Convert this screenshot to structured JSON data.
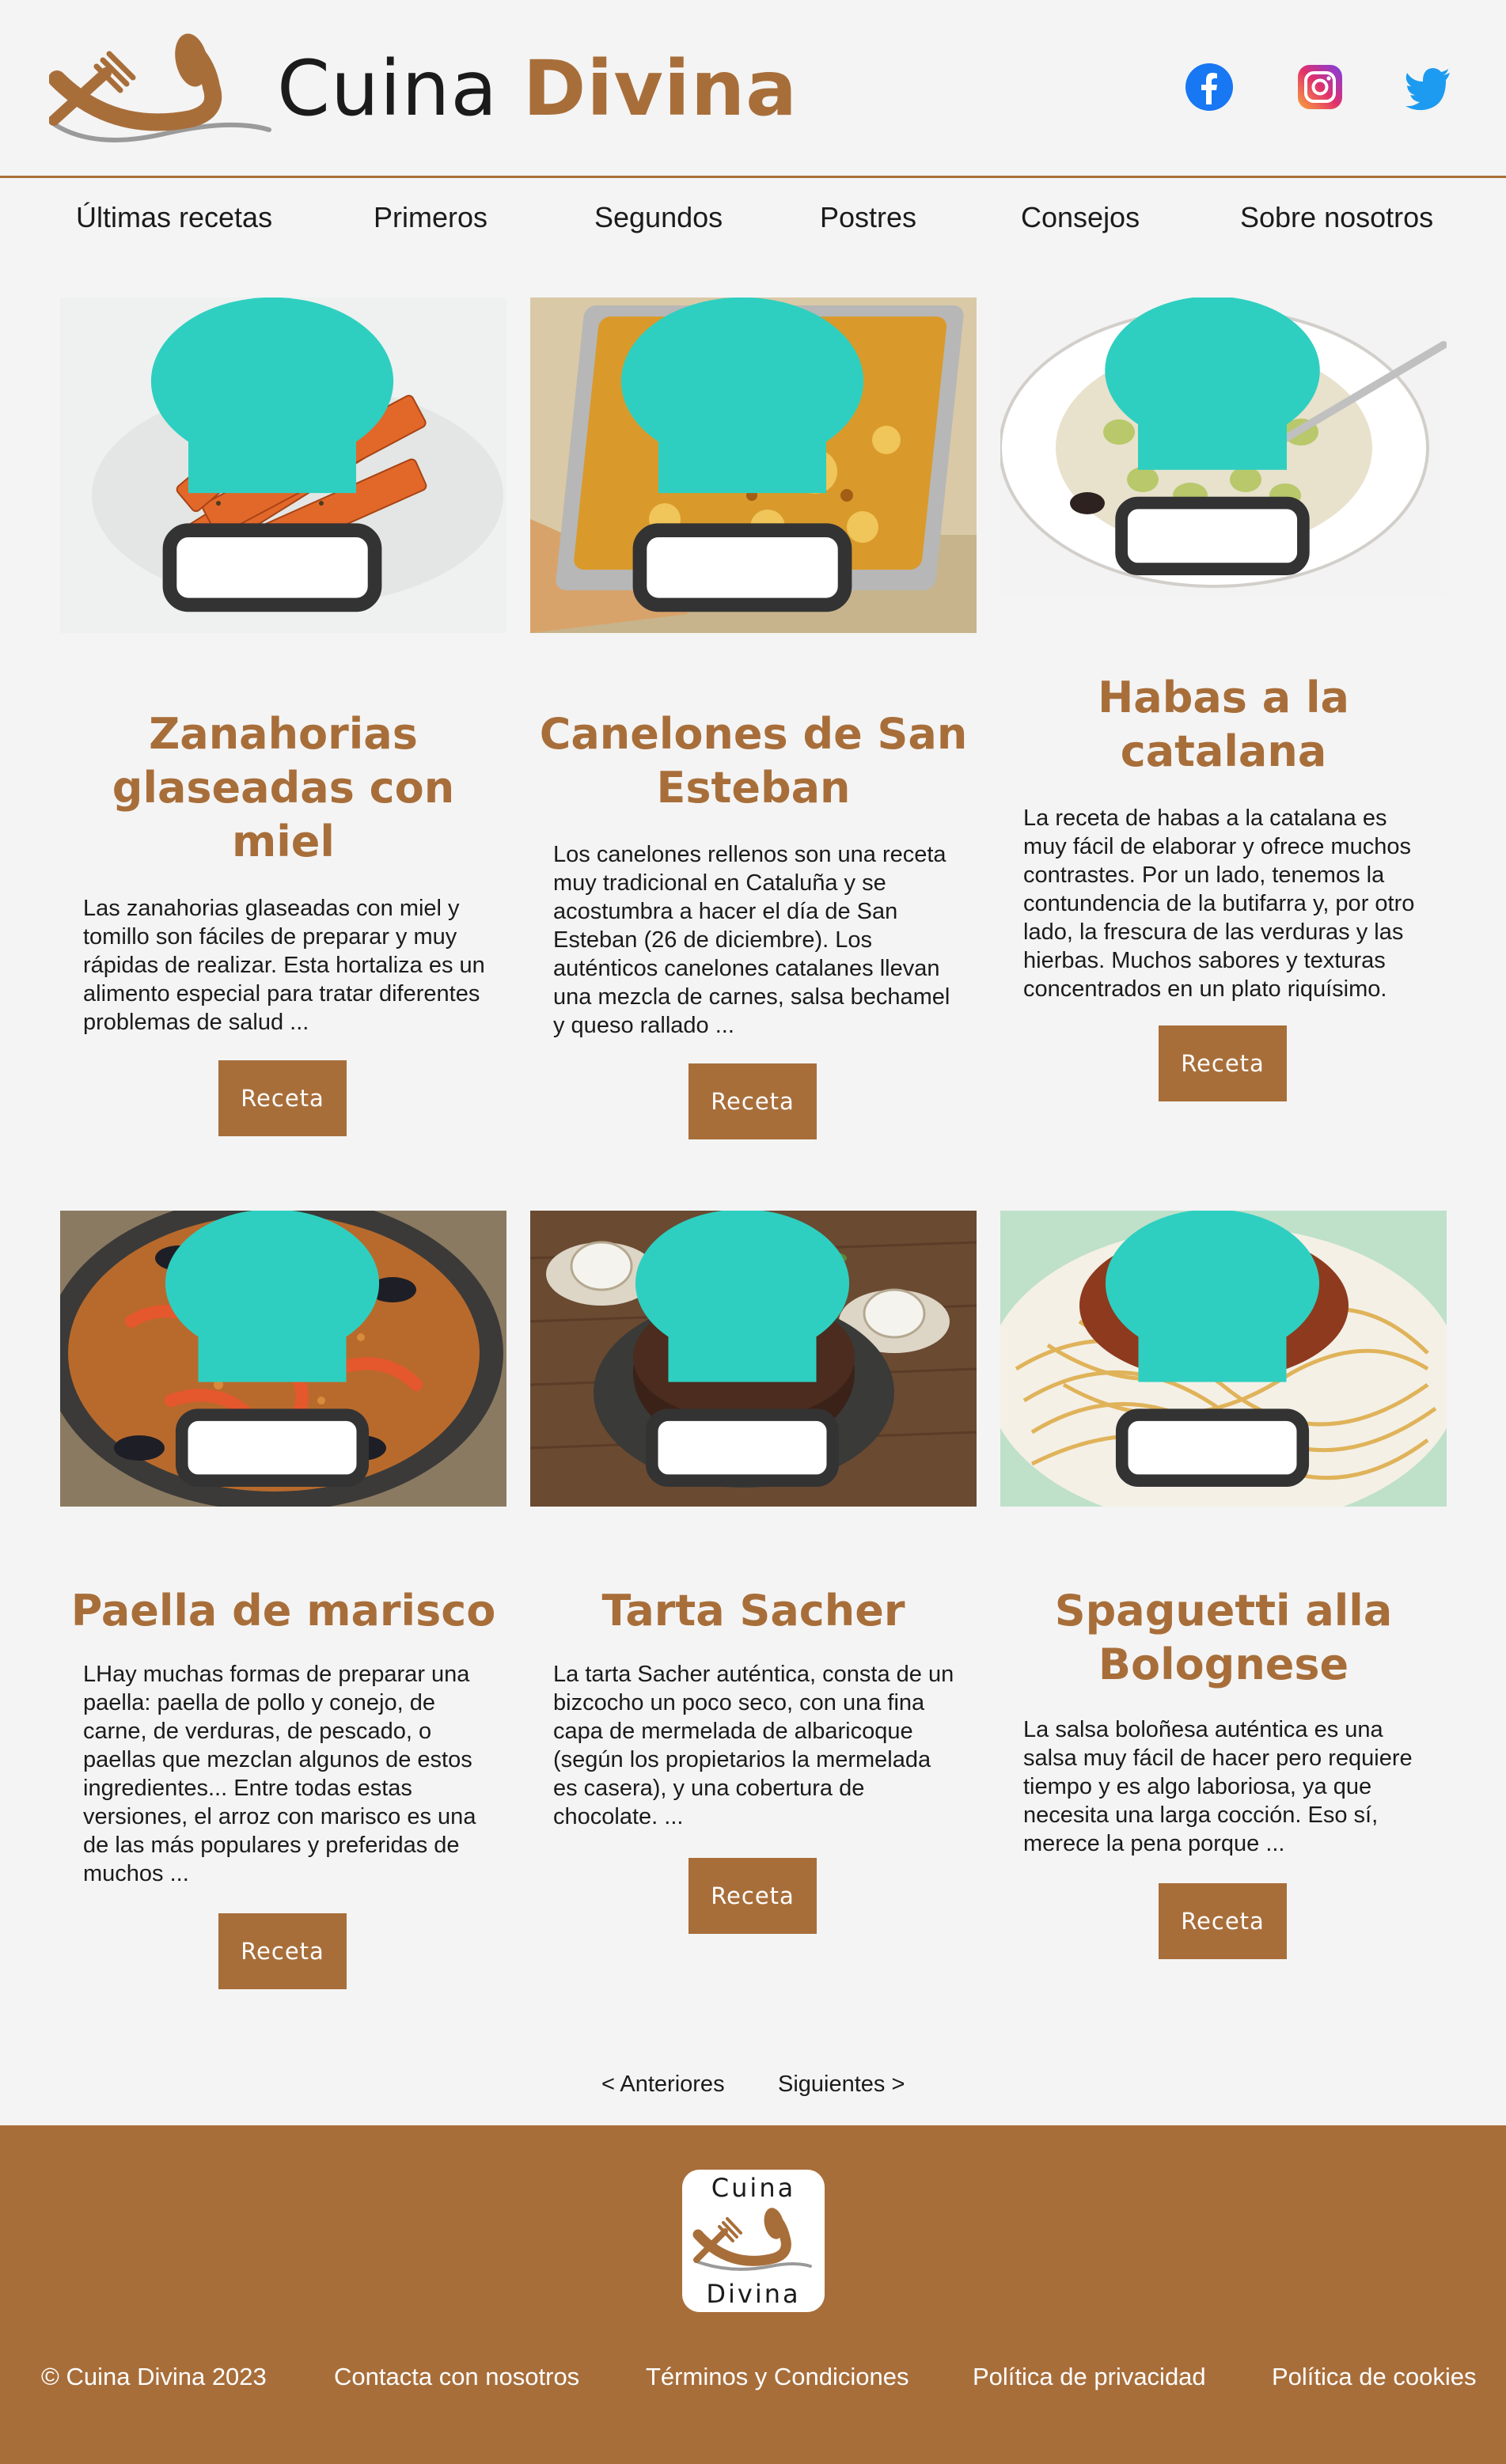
{
  "site": {
    "title_part1": "Cuina",
    "title_part2": "Divina"
  },
  "social": [
    "facebook-icon",
    "instagram-icon",
    "twitter-icon"
  ],
  "nav": [
    "Últimas recetas",
    "Primeros",
    "Segundos",
    "Postres",
    "Consejos",
    "Sobre nosotros"
  ],
  "recipes": [
    {
      "title": "Zanahorias glaseadas con miel",
      "text": "Las zanahorias glaseadas con miel y tomillo son fáciles de preparar y muy rápidas de realizar. Esta hortaliza es un alimento especial para tratar diferentes problemas de salud ...",
      "button": "Receta"
    },
    {
      "title": "Canelones de San Esteban",
      "text": "Los canelones rellenos son una receta muy tradicional en Cataluña y se acostumbra a hacer el día de San Esteban (26 de diciembre). Los auténticos canelones catalanes llevan una mezcla de carnes, salsa bechamel y queso rallado ...",
      "button": "Receta"
    },
    {
      "title": "Habas a la catalana",
      "text": "La receta de habas a la catalana es muy fácil de elaborar y ofrece muchos contrastes. Por un lado, tenemos la contundencia de la butifarra y, por otro lado, la frescura de las verduras y las hierbas. Muchos sabores y texturas concentrados en un plato riquísimo.",
      "button": "Receta"
    },
    {
      "title": "Paella de marisco",
      "text": "LHay muchas formas de preparar una paella: paella de pollo y conejo, de carne, de verduras, de pescado, o paellas que mezclan algunos de estos ingredientes... Entre todas estas versiones, el arroz con marisco es una de las más populares y preferidas de muchos ...",
      "button": "Receta"
    },
    {
      "title": "Tarta Sacher",
      "text": "La tarta Sacher auténtica, consta de un bizcocho un poco seco, con una fina capa de mermelada de albaricoque (según los propietarios la mermelada es casera), y una cobertura de chocolate. ...",
      "button": "Receta"
    },
    {
      "title": "Spaguetti alla Bolognese",
      "text": "La salsa boloñesa auténtica es una salsa muy fácil de hacer pero requiere tiempo y es algo laboriosa, ya que necesita una larga cocción. Eso sí, merece la pena porque ...",
      "button": "Receta"
    }
  ],
  "pagination": {
    "prev": "< Anteriores",
    "next": "Siguientes >"
  },
  "footer": {
    "logo_top": "Cuina",
    "logo_bottom": "Divina",
    "links": [
      "© Cuina Divina 2023",
      "Contacta con nosotros",
      "Términos y Condiciones",
      "Política de privacidad",
      "Política de cookies"
    ]
  },
  "colors": {
    "accent": "#a86e3a",
    "background": "#f4f4f4",
    "text": "#1b1b1b"
  }
}
